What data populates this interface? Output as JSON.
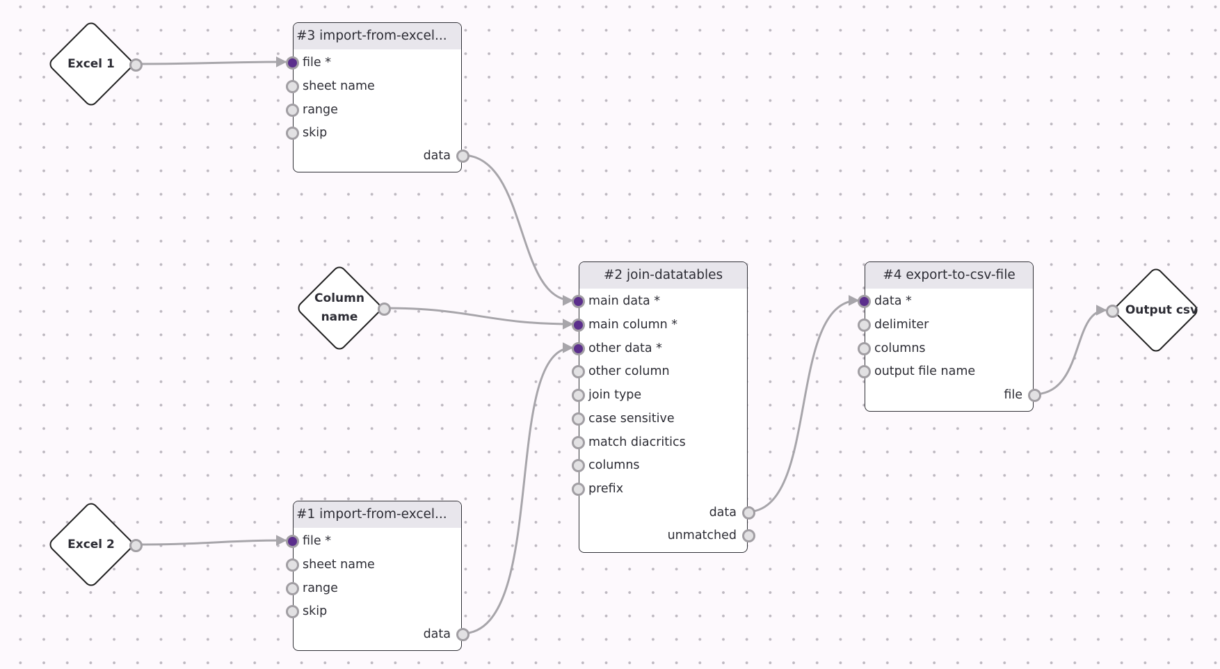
{
  "canvas": {
    "background": "#fdf9fd",
    "dot_color": "#bdb8c0"
  },
  "colors": {
    "wire": "#a7a5aa",
    "port_filled": "#5b2e8c",
    "port_empty": "#e2e1e3",
    "header_bg": "#e8e6ec"
  },
  "inputs": [
    {
      "id": "excel1",
      "label": "Excel 1"
    },
    {
      "id": "colname",
      "label": "Column name"
    },
    {
      "id": "excel2",
      "label": "Excel 2"
    }
  ],
  "outputs": [
    {
      "id": "outcsv",
      "label": "Output csv"
    }
  ],
  "nodes": {
    "n3": {
      "title": "#3 import-from-excel...",
      "inputs": [
        "file *",
        "sheet name",
        "range",
        "skip"
      ],
      "outputs": [
        "data"
      ]
    },
    "n1": {
      "title": "#1 import-from-excel...",
      "inputs": [
        "file *",
        "sheet name",
        "range",
        "skip"
      ],
      "outputs": [
        "data"
      ]
    },
    "n2": {
      "title": "#2 join-datatables",
      "inputs": [
        "main data *",
        "main column *",
        "other data *",
        "other column",
        "join type",
        "case sensitive",
        "match diacritics",
        "columns",
        "prefix"
      ],
      "outputs": [
        "data",
        "unmatched"
      ]
    },
    "n4": {
      "title": "#4 export-to-csv-file",
      "inputs": [
        "data *",
        "delimiter",
        "columns",
        "output file name"
      ],
      "outputs": [
        "file"
      ]
    }
  },
  "connections": [
    {
      "from": "Excel 1",
      "to": "#3 import-from-excel... / file *"
    },
    {
      "from": "Excel 2",
      "to": "#1 import-from-excel... / file *"
    },
    {
      "from": "#3 import-from-excel... / data",
      "to": "#2 join-datatables / main data *"
    },
    {
      "from": "Column name",
      "to": "#2 join-datatables / main column *"
    },
    {
      "from": "#1 import-from-excel... / data",
      "to": "#2 join-datatables / other data *"
    },
    {
      "from": "#2 join-datatables / data",
      "to": "#4 export-to-csv-file / data *"
    },
    {
      "from": "#4 export-to-csv-file / file",
      "to": "Output csv"
    }
  ]
}
